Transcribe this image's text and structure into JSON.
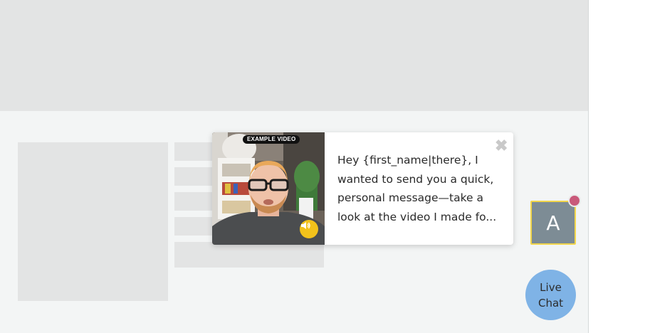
{
  "popup": {
    "video_badge": "EXAMPLE VIDEO",
    "message": "Hey {first_name|there}, I wanted to send you a quick, personal message—take a look at the video I made fo...",
    "close_glyph": "✖",
    "sound_icon": "speaker-icon"
  },
  "widget": {
    "avatar_letter": "A",
    "live_chat_line1": "Live",
    "live_chat_line2": "Chat"
  },
  "colors": {
    "accent_yellow": "#f2c21b",
    "avatar_bg": "#7d8c95",
    "avatar_border": "#f2d64b",
    "notification": "#c9597a",
    "live_chat_bg": "#7fb3e6"
  }
}
